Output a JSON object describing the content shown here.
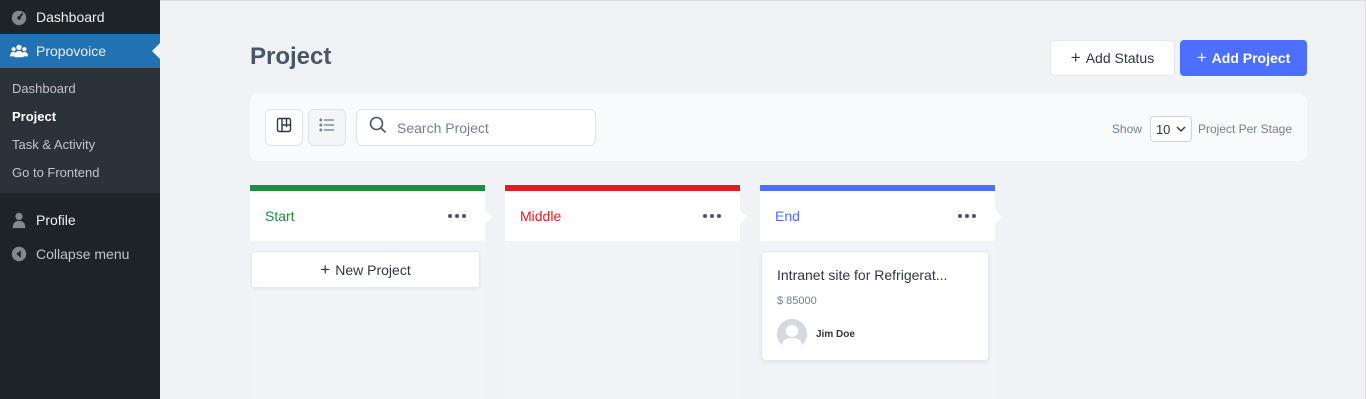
{
  "sidebar": {
    "items": [
      {
        "label": "Dashboard",
        "icon": "speedometer-icon"
      },
      {
        "label": "Propovoice",
        "icon": "users-group-icon"
      }
    ],
    "submenu": [
      "Dashboard",
      "Project",
      "Task & Activity",
      "Go to Frontend"
    ],
    "profile_label": "Profile",
    "collapse_label": "Collapse menu"
  },
  "header": {
    "title": "Project",
    "add_status_label": "Add Status",
    "add_project_label": "Add Project",
    "plus": "+"
  },
  "toolbar": {
    "search_placeholder": "Search Project",
    "show_label": "Show",
    "per_stage_value": "10",
    "per_stage_label": "Project Per Stage"
  },
  "columns": [
    {
      "title": "Start",
      "color": "#1e8e3e"
    },
    {
      "title": "Middle",
      "color": "#e01e1e"
    },
    {
      "title": "End",
      "color": "#4c6fff"
    }
  ],
  "new_project_label": "New Project",
  "card": {
    "title": "Intranet site for Refrigerat...",
    "budget": "$ 85000",
    "user": "Jim Doe"
  },
  "colors": {
    "accent": "#4c6fff",
    "sidebar_bg": "#1e2327",
    "sidebar_active": "#2271b1"
  }
}
